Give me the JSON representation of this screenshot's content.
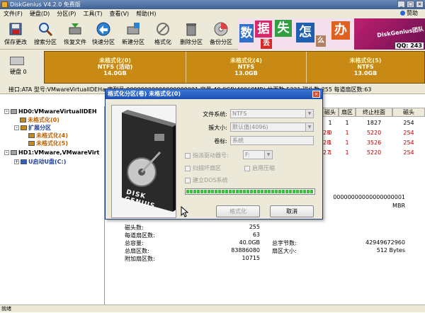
{
  "window": {
    "title": "DiskGenius V4.2.0 免费版"
  },
  "menu": [
    "文件(F)",
    "硬盘(D)",
    "分区(P)",
    "工具(T)",
    "查看(V)",
    "帮助(H)"
  ],
  "help_label": "赞助",
  "toolbar": [
    {
      "label": "保存更改",
      "icon": "save-icon"
    },
    {
      "label": "搜索分区",
      "icon": "magnifier-icon"
    },
    {
      "label": "恢复文件",
      "icon": "recover-icon"
    },
    {
      "label": "快速分区",
      "icon": "quick-partition-icon"
    },
    {
      "label": "新建分区",
      "icon": "new-partition-icon"
    },
    {
      "label": "格式化",
      "icon": "format-icon"
    },
    {
      "label": "删除分区",
      "icon": "trash-icon"
    },
    {
      "label": "备份分区",
      "icon": "backup-icon"
    }
  ],
  "banner": {
    "chars": [
      "数",
      "据",
      "丢",
      "失",
      "怎",
      "么",
      "办"
    ],
    "brand": "DiskGenius团队",
    "qq": "QQ: 243"
  },
  "disk": {
    "label": "硬盘 0"
  },
  "partitions": [
    {
      "name": "未格式化(0)",
      "fs": "NTFS (活动)",
      "size": "14.0GB"
    },
    {
      "name": "未格式化(4)",
      "fs": "NTFS",
      "size": "13.0GB"
    },
    {
      "name": "未格式化(5)",
      "fs": "NTFS",
      "size": "13.0GB"
    }
  ],
  "infoline": "接口:ATA  型号:VMwareVirtualIDEHa  序列号:00000000000000000001  容量:40.0GB(40960MB)  柱面数:5221  磁头数:255  每道扇区数:63",
  "tree": [
    {
      "text": "HD0:VMwareVirtualIDEH",
      "expander": "-"
    },
    {
      "text": "未格式化(0)"
    },
    {
      "text": "扩展分区",
      "expander": "-"
    },
    {
      "text": "未格式化(4)"
    },
    {
      "text": "未格式化(5)"
    },
    {
      "text": "HD1:VMware,VMwareVirt",
      "expander": "-"
    },
    {
      "text": "U启动U盘(C:)",
      "expander": "+"
    }
  ],
  "grid": {
    "headers": [
      "磁头",
      "扇区",
      "终止柱面",
      "磁头"
    ],
    "rows": [
      [
        "1",
        "1",
        "1827",
        "254"
      ],
      [
        "0",
        "1",
        "5220",
        "254"
      ],
      [
        "1",
        "1",
        "3526",
        "254"
      ],
      [
        "1",
        "1",
        "5220",
        "254"
      ]
    ],
    "partial_col": [
      "",
      "28",
      "28",
      "27"
    ]
  },
  "stats_right": {
    "serial": "00000000000000000001",
    "type": "MBR"
  },
  "stats": [
    {
      "label": "磁头数:",
      "value": "255"
    },
    {
      "label": "每道扇区数:",
      "value": "63"
    },
    {
      "label": "总容量:",
      "value": "40.0GB"
    },
    {
      "label": "总扇区数:",
      "value": "83886080"
    },
    {
      "label": "附加扇区数:",
      "value": "10715"
    }
  ],
  "stats2": [
    {
      "label": "总字节数:",
      "value": "42949672960"
    },
    {
      "label": "扇区大小:",
      "value": "512 Bytes"
    }
  ],
  "dialog": {
    "title": "格式化分区(卷) 未格式化(0)",
    "fs_label": "文件系统:",
    "fs_value": "NTFS",
    "cluster_label": "簇大小:",
    "cluster_value": "默认值(4096)",
    "vol_label": "卷标:",
    "vol_value": "系统",
    "chk_drive": "指派驱动器号:",
    "drive_value": "F:",
    "chk_scan": "扫描坏扇区",
    "chk_compress": "启用压缩",
    "chk_dos": "建立DOS系统",
    "progress": 1.0,
    "btn_format": "格式化",
    "btn_cancel": "取消",
    "img_text": "DISK GENIUS"
  },
  "status": "就绪"
}
